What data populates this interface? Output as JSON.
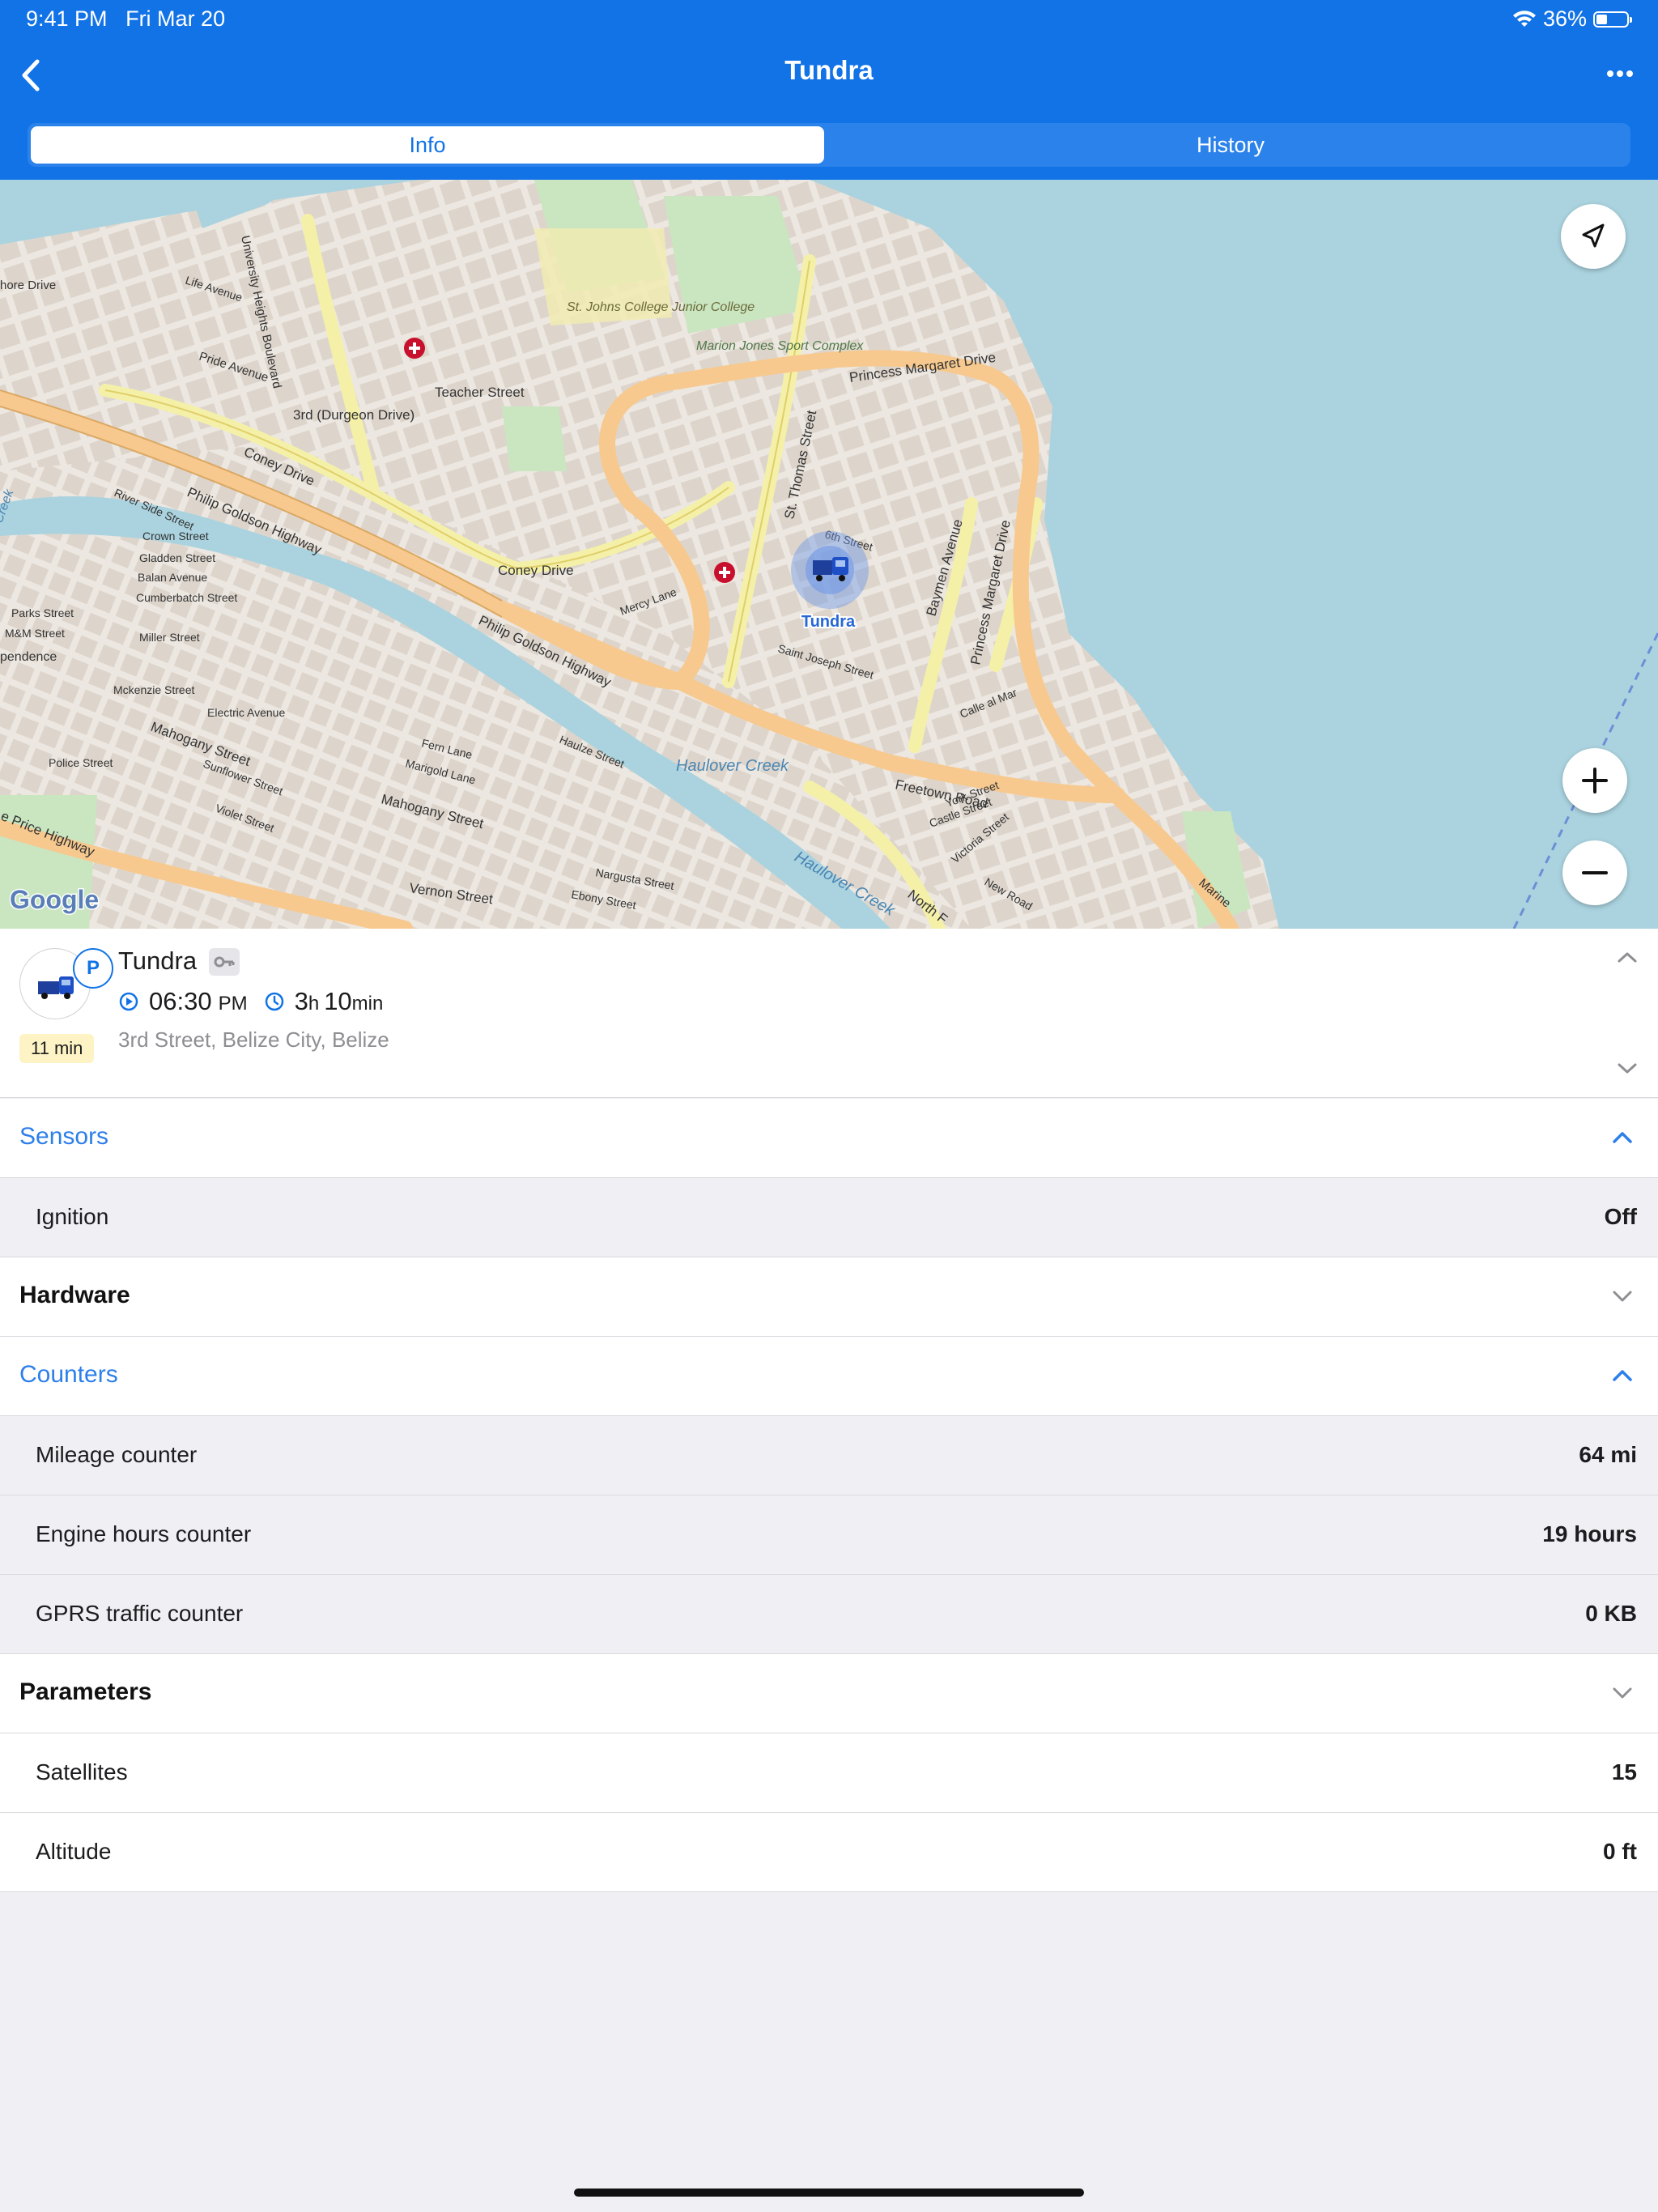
{
  "status_bar": {
    "time": "9:41 PM",
    "date": "Fri Mar 20",
    "battery": "36%",
    "battery_level": 0.36
  },
  "header": {
    "title": "Tundra",
    "back_icon": "chevron-left-icon",
    "more_icon": "ellipsis-icon",
    "tabs": [
      {
        "label": "Info",
        "active": true
      },
      {
        "label": "History",
        "active": false
      }
    ]
  },
  "map": {
    "provider_logo": "Google",
    "marker_label": "Tundra",
    "street_labels": {
      "philip_goldson_1": "Philip Goldson Highway",
      "philip_goldson_2": "Philip Goldson Highway",
      "princess_margaret": "Princess Margaret Drive",
      "princess_margaret_2": "Princess Margaret Drive",
      "coney_1": "Coney Drive",
      "coney_2": "Coney Drive",
      "freetown": "Freetown Road",
      "st_thomas": "St. Thomas Street",
      "baymen": "Baymen Avenue",
      "mahogany_1": "Mahogany Street",
      "mahogany_2": "Mahogany Street",
      "vernon": "Vernon Street",
      "teacher": "Teacher Street",
      "third": "3rd (Durgeon Drive)",
      "haulover": "Haulover Creek",
      "haulover_2": "Haulover Creek",
      "st_johns": "St. Johns College Junior College",
      "marion_jones": "Marion Jones Sport Complex",
      "price_hwy": "e Price Highway",
      "north_front": "North F",
      "pride": "Pride Avenue",
      "shore": "hore Drive",
      "crown": "Crown Street",
      "gladden": "Gladden Street",
      "balan": "Balan Avenue",
      "cumberbatch": "Cumberbatch Street",
      "parks": "Parks Street",
      "mm": "M&M Street",
      "miller": "Miller Street",
      "mckenzie": "Mckenzie Street",
      "electric": "Electric Avenue",
      "police": "Police Street",
      "sunflower": "Sunflower Street",
      "violet": "Violet Street",
      "fern": "Fern Lane",
      "marigold": "Marigold Lane",
      "haulze": "Haulze Street",
      "nargusta": "Nargusta Street",
      "ebony": "Ebony Street",
      "york": "York Street",
      "castle": "Castle Street",
      "victoria": "Victoria Street",
      "new_road": "New Road",
      "saint_joseph": "Saint Joseph Street",
      "mercy": "Mercy Lane",
      "sixth": "6th Street",
      "calle_al_mar": "Calle al Mar",
      "marine": "Marine",
      "river_side": "River Side Street",
      "life": "Life Avenue",
      "university_heights": "University Heights Boulevard",
      "pendence": "pendence",
      "creek": "Creek"
    },
    "locate_icon": "navigation-arrow-icon",
    "zoom_in_icon": "plus-icon",
    "zoom_out_icon": "minus-icon"
  },
  "vehicle": {
    "name": "Tundra",
    "parking_badge": "P",
    "duration_badge": "11 min",
    "time_value": "06:30",
    "time_suffix": "PM",
    "duration_hours": "3",
    "duration_hours_unit": "h",
    "duration_minutes": "10",
    "duration_minutes_unit": "min",
    "address": "3rd Street, Belize City, Belize"
  },
  "sections": {
    "sensors": {
      "title": "Sensors",
      "expanded": true
    },
    "ignition": {
      "label": "Ignition",
      "value": "Off"
    },
    "hardware": {
      "title": "Hardware",
      "expanded": false
    },
    "counters": {
      "title": "Counters",
      "expanded": true
    },
    "mileage": {
      "label": "Mileage counter",
      "value": "64 mi"
    },
    "engine_hours": {
      "label": "Engine hours counter",
      "value": "19 hours"
    },
    "gprs": {
      "label": "GPRS traffic counter",
      "value": "0 KB"
    },
    "parameters": {
      "title": "Parameters",
      "expanded": false
    },
    "satellites": {
      "label": "Satellites",
      "value": "15"
    },
    "altitude": {
      "label": "Altitude",
      "value": "0 ft"
    }
  },
  "colors": {
    "header_blue": "#1273e6",
    "accent_blue": "#2d7fea",
    "map_water": "#aad3df",
    "road_major": "#f7c98e",
    "road_secondary": "#f5f0a8",
    "badge_yellow": "#fdf3c4"
  }
}
